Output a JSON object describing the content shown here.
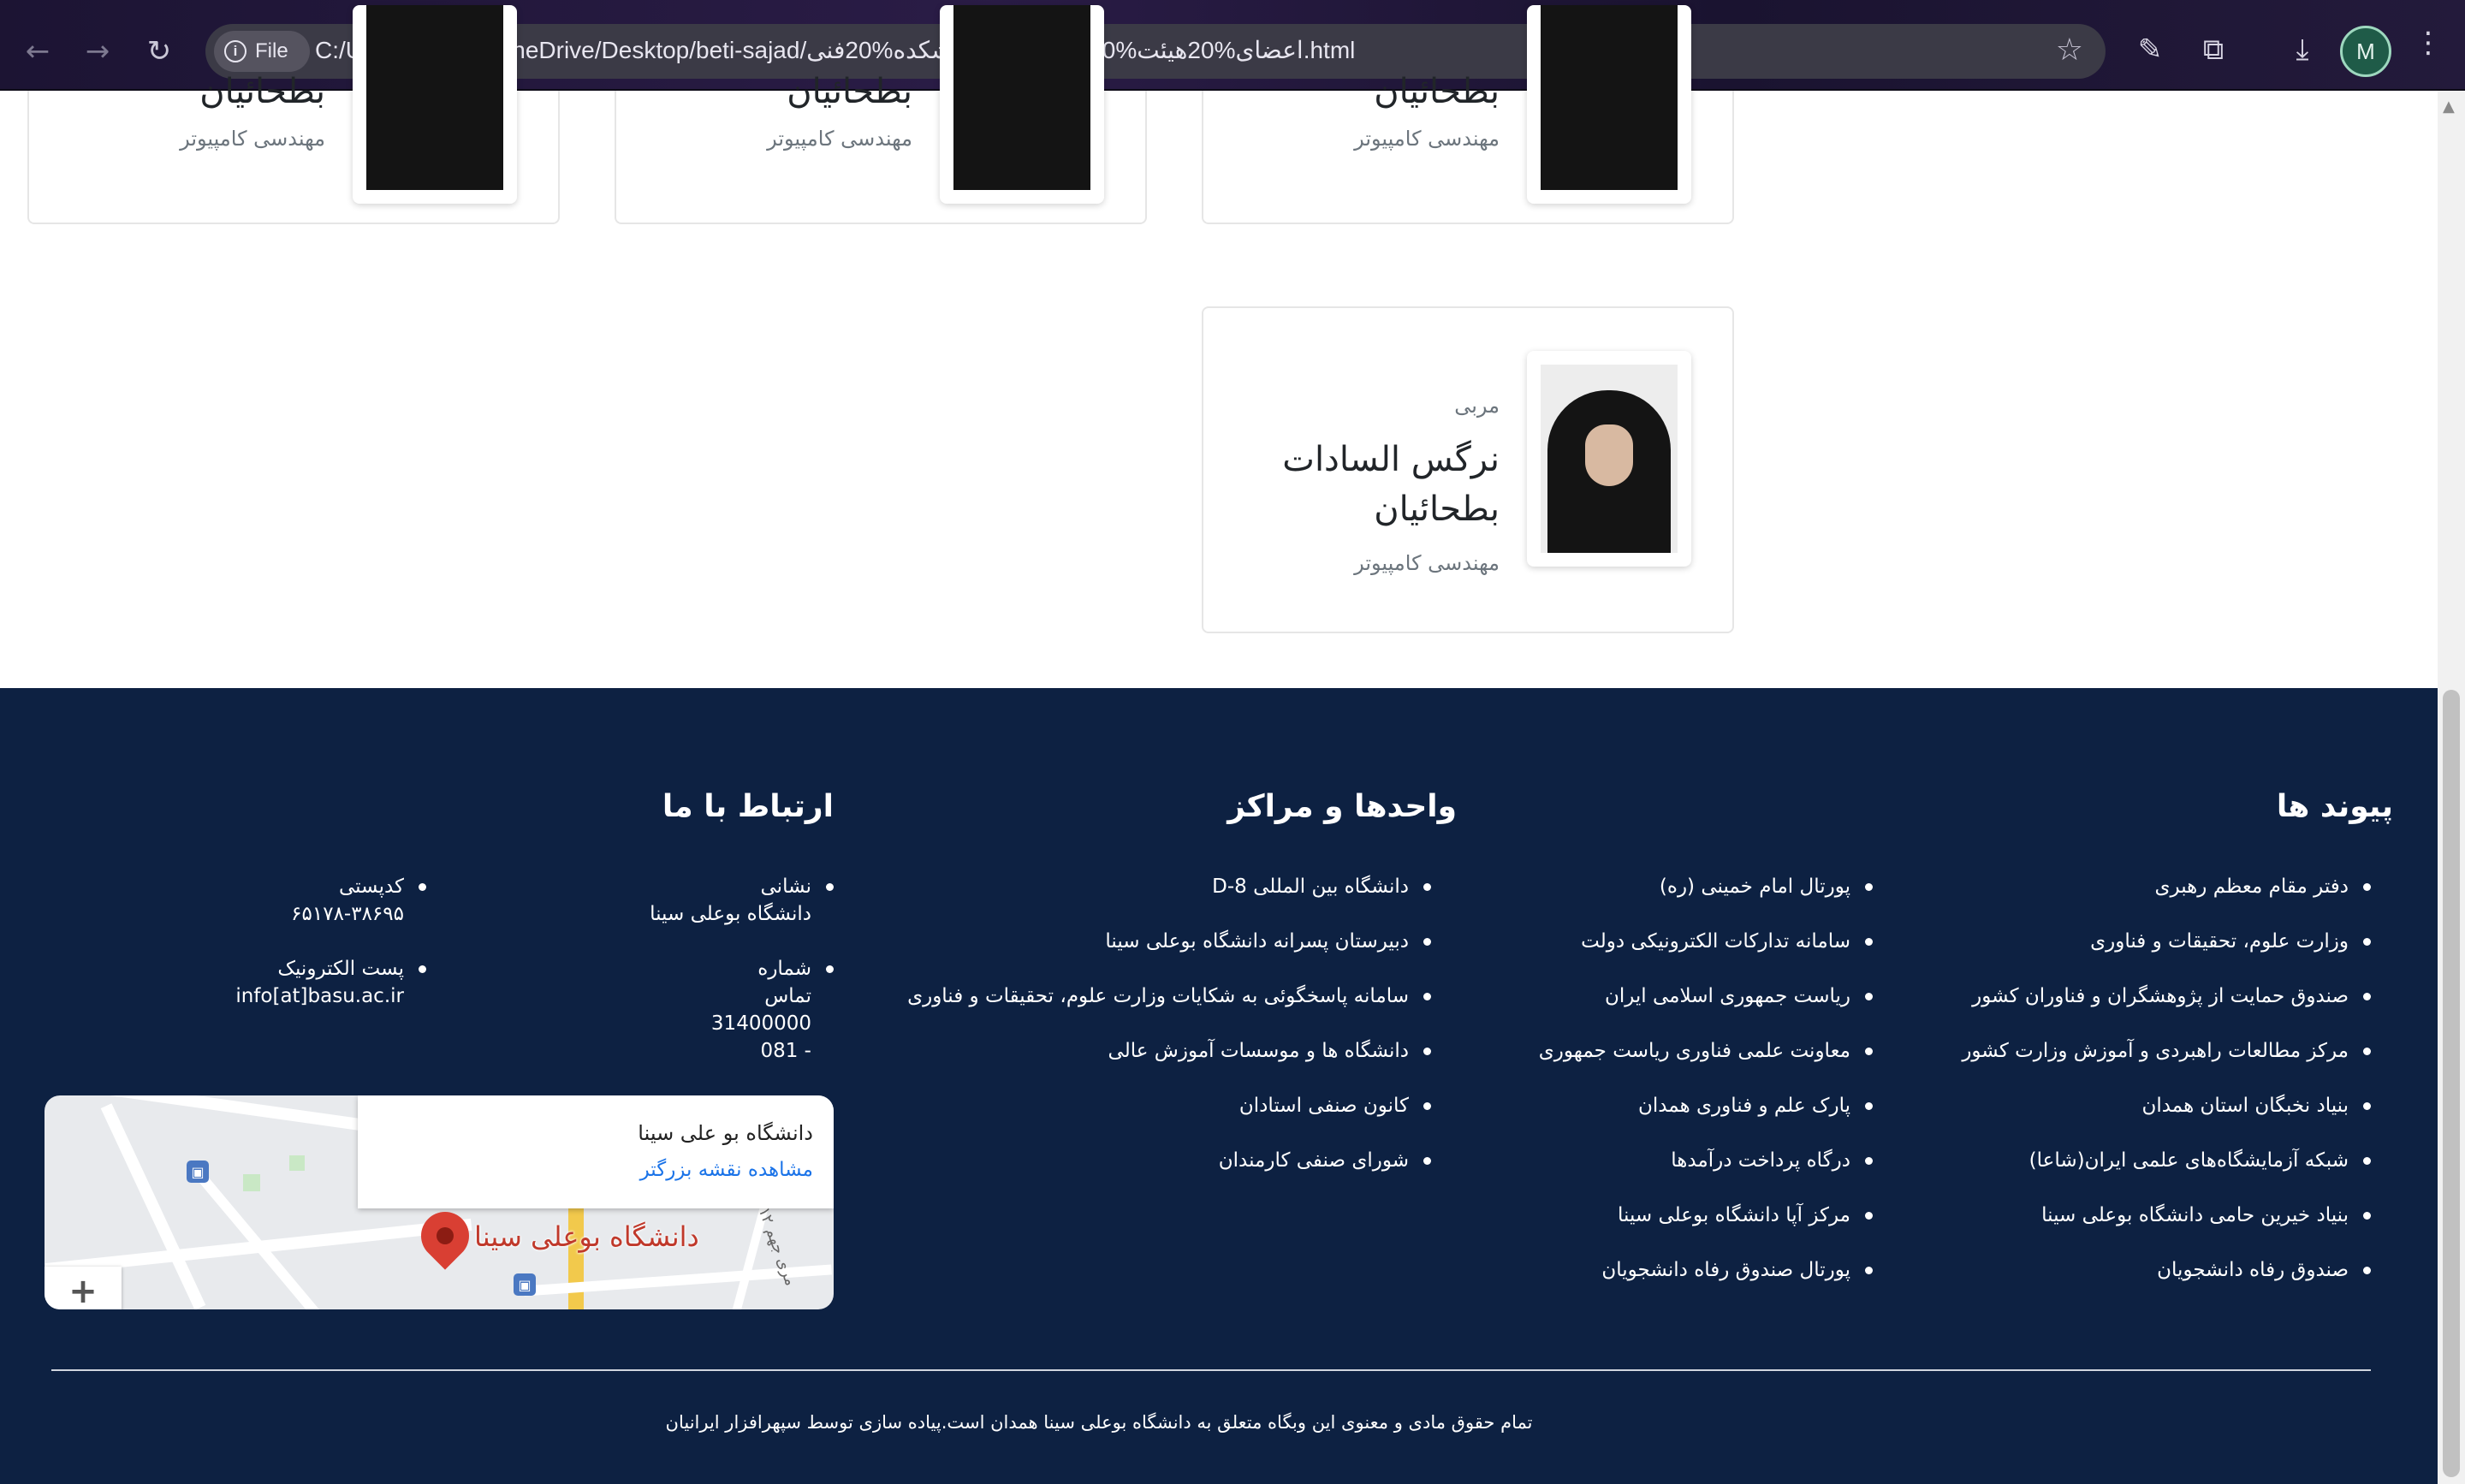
{
  "browser": {
    "file_chip_label": "File",
    "url": "C:/Users/m210s/OneDrive/Desktop/beti-sajad/اعضای%20هیئت%20علمی-%20دانشکده%20فنی.html",
    "avatar_letter": "M",
    "accent": "#1f5b48"
  },
  "members": [
    {
      "name": "بطحائیان",
      "dept": "مهندسی کامپیوتر"
    },
    {
      "name": "بطحائیان",
      "dept": "مهندسی کامپیوتر"
    },
    {
      "name": "بطحائیان",
      "dept": "مهندسی کامپیوتر"
    },
    {
      "role": "مربی",
      "name": "نرگس السادات بطحائیان",
      "dept": "مهندسی کامپیوتر"
    }
  ],
  "footer": {
    "bg_color": "#0d2142",
    "links_heading": "پیوند ها",
    "links_col1": [
      "دفتر مقام معظم رهبری",
      "وزارت علوم، تحقیقات و فناوری",
      "صندوق حمایت از پژوهشگران و فناوران کشور",
      "مرکز مطالعات راهبردی و آموزش وزارت کشور",
      "بنیاد نخبگان استان همدان",
      "شبکه آزمایشگاه‌های علمی ایران(شاعا)",
      "بنیاد خیرین حامی دانشگاه بوعلی سینا",
      "صندوق رفاه دانشجویان"
    ],
    "links_col2": [
      "پورتال امام خمینی (ره)",
      "سامانه تدارکات الکترونیکی دولت",
      "ریاست جمهوری اسلامی ایران",
      "معاونت علمی فناوری ریاست جمهوری",
      "پارک علم و فناوری همدان",
      "درگاه پرداخت درآمدها",
      "مرکز آپا دانشگاه بوعلی سینا",
      "پورتال صندوق رفاه دانشجویان"
    ],
    "units_heading": "واحدها و مراکز",
    "units": [
      "دانشگاه بین المللی D-8",
      "دبیرستان پسرانه دانشگاه بوعلی سینا",
      "سامانه پاسخگوئی به شکایات وزارت علوم، تحقیقات و فناوری",
      "دانشگاه ها و موسسات آموزش عالی",
      "کانون صنفی استادان",
      "شورای صنفی کارمندان"
    ],
    "contact_heading": "ارتباط با ما",
    "address_label": "نشانی",
    "address_value": "دانشگاه بوعلی سینا",
    "postal_label": "کدپستی",
    "postal_value": "۶۵۱۷۸-۳۸۶۹۵",
    "phone_label_1": "شماره",
    "phone_label_2": "تماس",
    "phone_value_1": "31400000",
    "phone_value_2": "- 081",
    "email_label": "پست الکترونیک",
    "email_value": "info[at]basu.ac.ir",
    "map": {
      "place_title": "دانشگاه بو علی سینا",
      "larger_map_link": "مشاهده نقشه بزرگتر",
      "pin_label": "دانشگاه بوعلی سینا",
      "street_label": "۱۲ مری جهم"
    },
    "copyright": "تمام حقوق مادی و معنوی این وبگاه متعلق به دانشگاه بوعلی سینا همدان است.پیاده سازی توسط سپهرافزار ایرانیان"
  }
}
